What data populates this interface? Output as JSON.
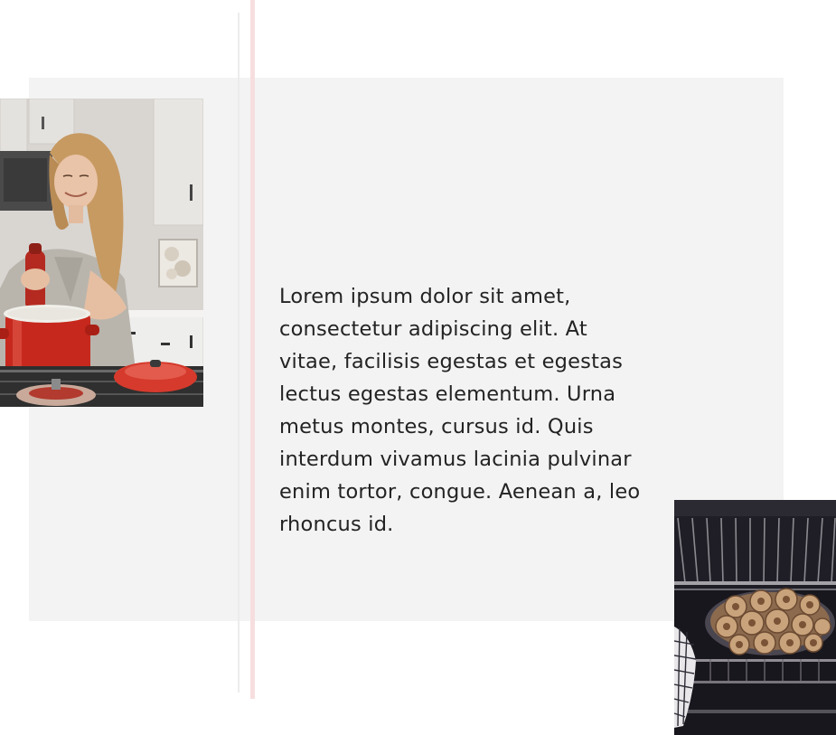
{
  "content": {
    "paragraph": "Lorem ipsum dolor sit amet, consectetur adipiscing elit. At vitae, facilisis egestas et egestas lectus egestas elementum. Urna metus montes, cursus id. Quis interdum vivamus lacinia pulvinar enim tortor, congue. Aenean a, leo rhoncus id."
  },
  "images": {
    "kitchen_photo": "woman-cooking-photo",
    "oven_photo": "cinnamon-rolls-oven-photo"
  },
  "colors": {
    "panel_background": "#f3f3f3",
    "accent_line": "#f7dede",
    "divider_line": "#ececec",
    "text": "#232323"
  }
}
